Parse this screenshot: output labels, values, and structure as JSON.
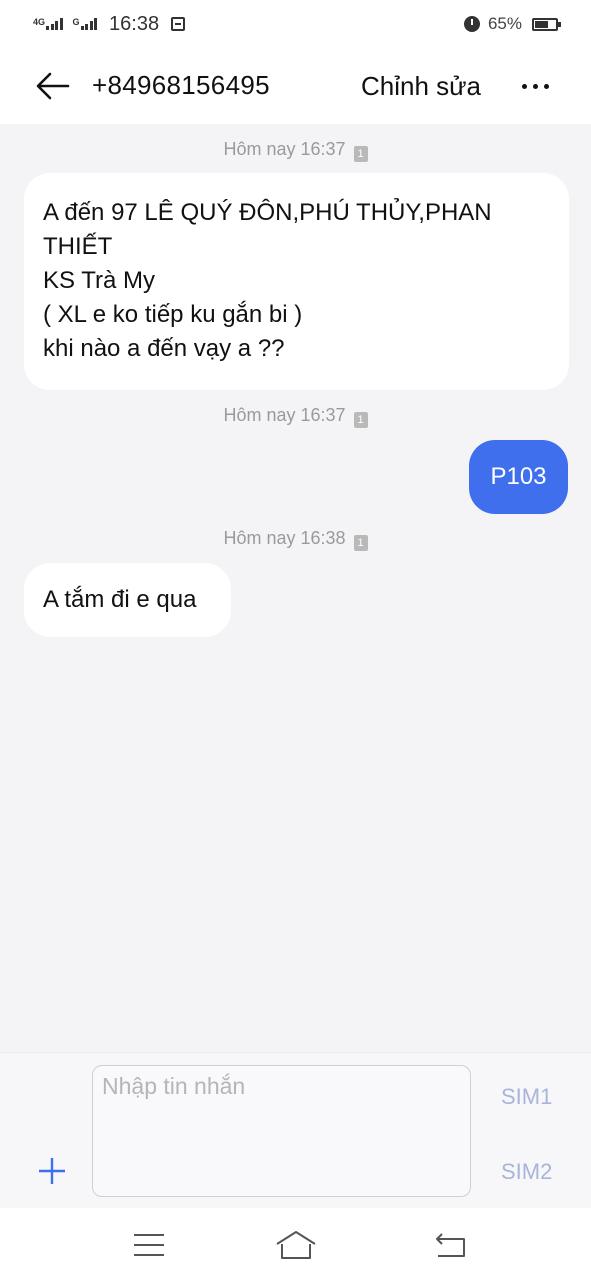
{
  "status_bar": {
    "network_1": "4G",
    "network_2": "G",
    "time": "16:38",
    "battery": "65%",
    "battery_level": 0.65
  },
  "header": {
    "contact": "+84968156495",
    "edit_label": "Chỉnh sửa"
  },
  "messages": [
    {
      "timestamp": "Hôm nay 16:37",
      "direction": "incoming",
      "lines": [
        "A đến 97 LÊ QUÝ ĐÔN,PHÚ THỦY,PHAN",
        "THIẾT",
        "KS Trà My",
        "( XL e ko tiếp ku gắn bi )",
        "khi nào a đến vạy a ??"
      ]
    },
    {
      "timestamp": "Hôm nay 16:37",
      "direction": "outgoing",
      "lines": [
        "P103"
      ]
    },
    {
      "timestamp": "Hôm nay 16:38",
      "direction": "incoming",
      "lines": [
        "A tắm đi e qua"
      ]
    }
  ],
  "composer": {
    "placeholder": "Nhập tin nhắn",
    "sim1": "SIM1",
    "sim2": "SIM2"
  },
  "icons": [
    "back-arrow-icon",
    "more-icon",
    "sim-icon",
    "plus-icon",
    "menu-icon",
    "home-icon",
    "back-icon"
  ],
  "colors": {
    "outgoing_bubble": "#3f6fed",
    "incoming_bubble": "#ffffff",
    "background": "#f4f4f6"
  }
}
